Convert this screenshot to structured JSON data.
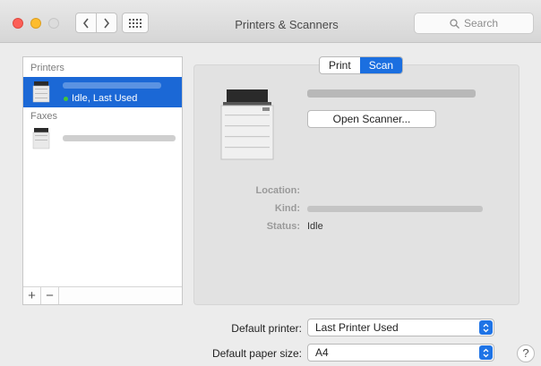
{
  "window": {
    "title": "Printers & Scanners",
    "search_placeholder": "Search"
  },
  "sidebar": {
    "printers_header": "Printers",
    "faxes_header": "Faxes",
    "printer_status": "Idle, Last Used",
    "add_label": "+",
    "remove_label": "−"
  },
  "tabs": {
    "print": "Print",
    "scan": "Scan",
    "active": "Scan"
  },
  "detail": {
    "open_scanner": "Open Scanner...",
    "location_label": "Location:",
    "kind_label": "Kind:",
    "status_label": "Status:",
    "status_value": "Idle"
  },
  "defaults": {
    "printer_label": "Default printer:",
    "printer_value": "Last Printer Used",
    "paper_label": "Default paper size:",
    "paper_value": "A4"
  },
  "help_label": "?",
  "colors": {
    "accent": "#1b68d6",
    "status_green": "#43c43a"
  }
}
